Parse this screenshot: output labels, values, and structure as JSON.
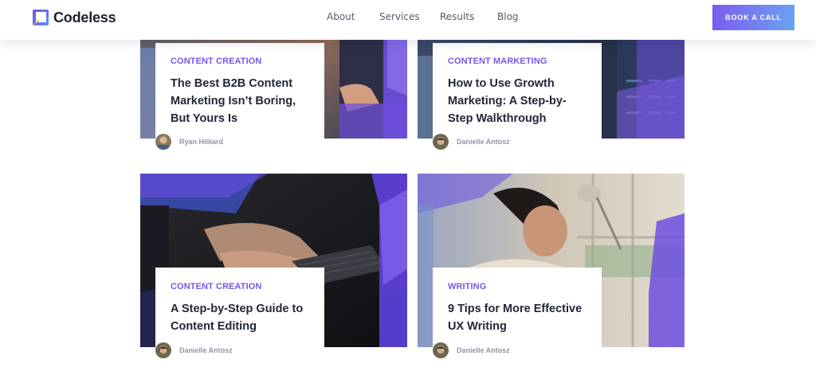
{
  "header": {
    "logo_text": "Codeless",
    "nav": [
      "About",
      "Services",
      "Results",
      "Blog"
    ],
    "cta": "BOOK A CALL"
  },
  "posts": [
    {
      "category": "CONTENT CREATION",
      "title": "The Best B2B Content Marketing Isn’t Boring, But Yours Is",
      "author": "Ryan Hilliard"
    },
    {
      "category": "CONTENT MARKETING",
      "title": "How to Use Growth Marketing: A Step-by-Step Walkthrough",
      "author": "Danielle Antosz"
    },
    {
      "category": "CONTENT CREATION",
      "title": "A Step-by-Step Guide to Content Editing",
      "author": "Danielle Antosz"
    },
    {
      "category": "WRITING",
      "title": "9 Tips for More Effective UX Writing",
      "author": "Danielle Antosz"
    }
  ],
  "colors": {
    "accent": "#7a55e8",
    "title": "#222639",
    "meta": "#9096a3",
    "cta_gradient_start": "#7b5cf0",
    "cta_gradient_end": "#6aa3f2"
  }
}
